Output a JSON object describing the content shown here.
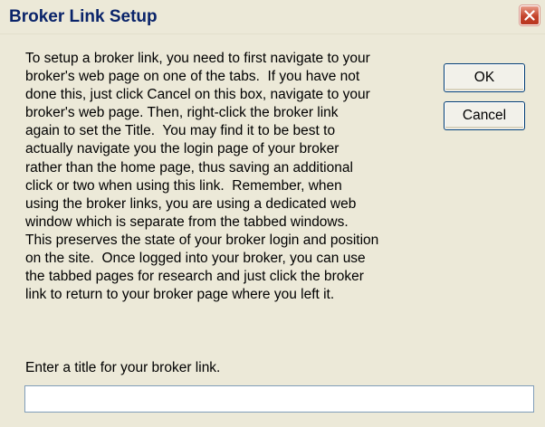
{
  "window": {
    "title": "Broker Link Setup"
  },
  "message_lines": [
    "To setup a broker link, you need to first navigate to your",
    "broker's web page on one of the tabs.  If you have not",
    "done this, just click Cancel on this box, navigate to your",
    "broker's web page. Then, right-click the broker link",
    "again to set the Title.  You may find it to be best to",
    "actually navigate you the login page of your broker",
    "rather than the home page, thus saving an additional",
    "click or two when using this link.  Remember, when",
    "using the broker links, you are using a dedicated web",
    "window which is separate from the tabbed windows.",
    "This preserves the state of your broker login and position",
    "on the site.  Once logged into your broker, you can use",
    "the tabbed pages for research and just click the broker",
    "link to return to your broker page where you left it."
  ],
  "buttons": {
    "ok_label": "OK",
    "cancel_label": "Cancel"
  },
  "prompt": {
    "label": "Enter a title for your broker link.",
    "value": ""
  },
  "icons": {
    "close": "close-icon"
  },
  "colors": {
    "dialog_background": "#ece9d8",
    "title_text": "#0a246a",
    "close_button": "#c4432b",
    "button_border": "#003c74",
    "input_border": "#7f9db9"
  }
}
